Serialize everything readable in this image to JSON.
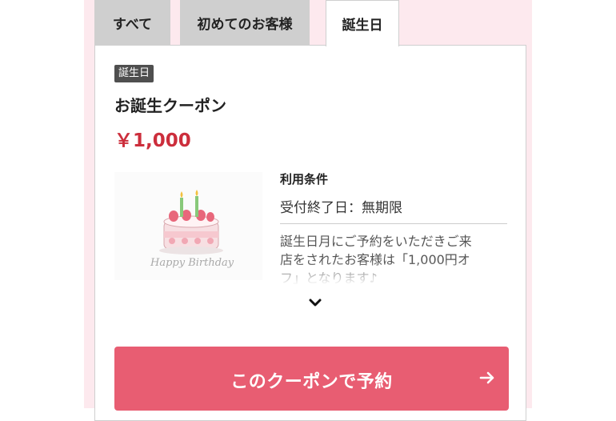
{
  "tabs": [
    {
      "label": "すべて",
      "active": false
    },
    {
      "label": "初めてのお客様",
      "active": false
    },
    {
      "label": "誕生日",
      "active": true
    }
  ],
  "coupon": {
    "category_badge": "誕生日",
    "title": "お誕生クーポン",
    "price": "￥1,000",
    "image_caption": "Happy Birthday",
    "conditions_heading": "利用条件",
    "expiry": "受付終了日：無期限",
    "description_lines": [
      "誕生日月にご予約をいただきご来",
      "店をされたお客様は「1,000円オ",
      "フ」となります♪"
    ]
  },
  "cta": {
    "label": "このクーポンで予約"
  },
  "colors": {
    "accent": "#e85d72",
    "price": "#cc2e3c",
    "badge_bg": "#4f4f4f",
    "frame_bg": "#fde9ee",
    "tab_inactive": "#cfcfcf"
  },
  "icons": [
    "chevron-down-icon",
    "arrow-right-icon",
    "birthday-cake-icon"
  ]
}
